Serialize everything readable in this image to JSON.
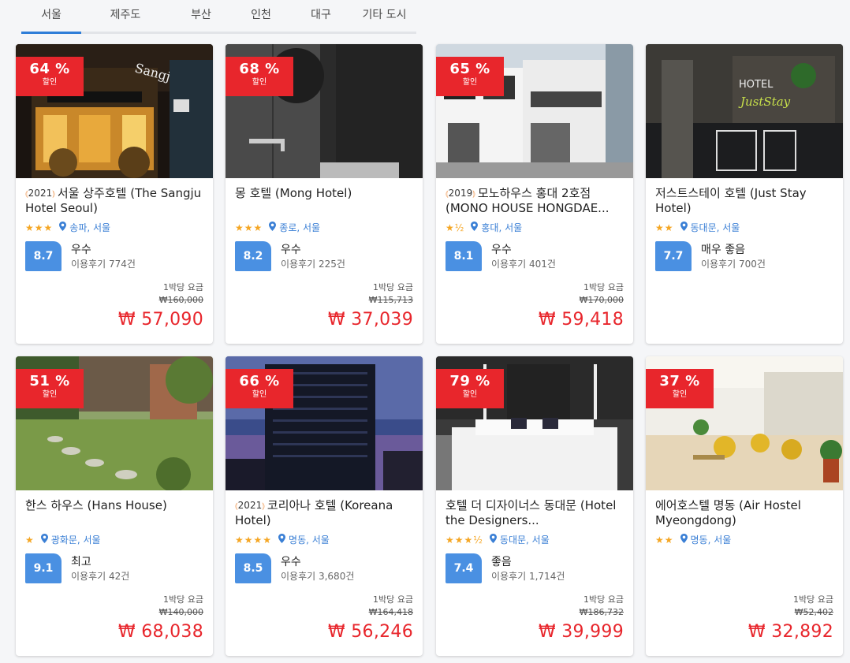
{
  "tabs": [
    "서울",
    "제주도",
    "부산",
    "인천",
    "대구",
    "기타 도시"
  ],
  "active_tab": 0,
  "colors": {
    "accent": "#2f7ed8",
    "discount": "#e8262c",
    "score": "#4a90e2",
    "stars": "#f5a623",
    "location": "#3a7fd5"
  },
  "hotels": [
    {
      "discount": "64 %",
      "discount_label": "할인",
      "award": "2021",
      "name": "서울 상주호텔 (The Sangju Hotel Seoul)",
      "stars": "★★★",
      "location": "송파, 서울",
      "score": "8.7",
      "score_word": "우수",
      "reviews": "이용후기 774건",
      "per_night": "1박당 요금",
      "old_price": "₩160,000",
      "price": "₩ 57,090",
      "image": "hotel-night-facade"
    },
    {
      "discount": "68 %",
      "discount_label": "할인",
      "award": "",
      "name": "몽 호텔 (Mong Hotel)",
      "stars": "★★★",
      "location": "종로, 서울",
      "score": "8.2",
      "score_word": "우수",
      "reviews": "이용후기 225건",
      "per_night": "1박당 요금",
      "old_price": "₩115,713",
      "price": "₩ 37,039",
      "image": "dark-bathroom"
    },
    {
      "discount": "65 %",
      "discount_label": "할인",
      "award": "2019",
      "name": "모노하우스 홍대 2호점 (MONO HOUSE HONGDAE...",
      "stars": "★½",
      "location": "홍대, 서울",
      "score": "8.1",
      "score_word": "우수",
      "reviews": "이용후기 401건",
      "per_night": "1박당 요금",
      "old_price": "₩170,000",
      "price": "₩ 59,418",
      "image": "white-house"
    },
    {
      "discount": "",
      "discount_label": "",
      "award": "",
      "name": "저스트스테이 호텔 (Just Stay Hotel)",
      "stars": "★★",
      "location": "동대문, 서울",
      "score": "7.7",
      "score_word": "매우 좋음",
      "reviews": "이용후기 700건",
      "per_night": "",
      "old_price": "",
      "price": "",
      "image": "just-stay-sign"
    },
    {
      "discount": "51 %",
      "discount_label": "할인",
      "award": "",
      "name": "한스 하우스 (Hans House)",
      "stars": "★",
      "location": "광화문, 서울",
      "score": "9.1",
      "score_word": "최고",
      "reviews": "이용후기 42건",
      "per_night": "1박당 요금",
      "old_price": "₩140,000",
      "price": "₩ 68,038",
      "image": "garden"
    },
    {
      "discount": "66 %",
      "discount_label": "할인",
      "award": "2021",
      "name": "코리아나 호텔 (Koreana Hotel)",
      "stars": "★★★★",
      "location": "명동, 서울",
      "score": "8.5",
      "score_word": "우수",
      "reviews": "이용후기 3,680건",
      "per_night": "1박당 요금",
      "old_price": "₩164,418",
      "price": "₩ 56,246",
      "image": "tower-dusk"
    },
    {
      "discount": "79 %",
      "discount_label": "할인",
      "award": "",
      "name": "호텔 더 디자이너스 동대문 (Hotel the Designers...",
      "stars": "★★★½",
      "location": "동대문, 서울",
      "score": "7.4",
      "score_word": "좋음",
      "reviews": "이용후기 1,714건",
      "per_night": "1박당 요금",
      "old_price": "₩186,732",
      "price": "₩ 39,999",
      "image": "white-bedroom"
    },
    {
      "discount": "37 %",
      "discount_label": "할인",
      "award": "",
      "name": "에어호스텔 명동 (Air Hostel Myeongdong)",
      "stars": "★★",
      "location": "명동, 서울",
      "score": "",
      "score_word": "",
      "reviews": "",
      "per_night": "1박당 요금",
      "old_price": "₩52,402",
      "price": "₩ 32,892",
      "image": "lounge-yellow-chairs"
    }
  ]
}
